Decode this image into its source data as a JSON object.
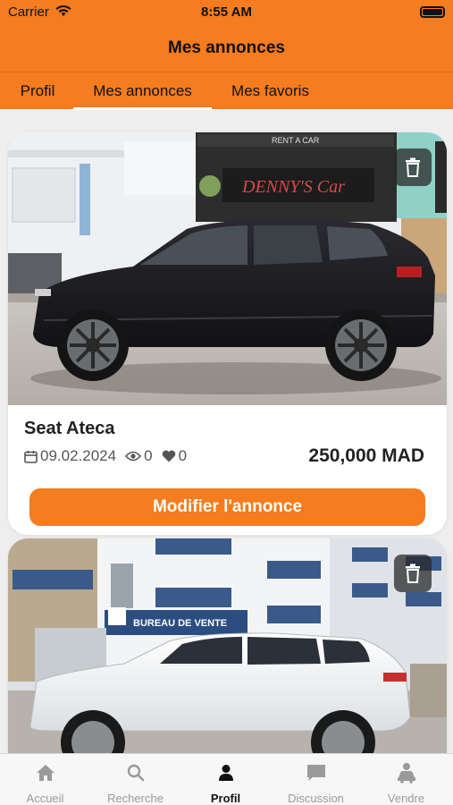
{
  "status_bar": {
    "carrier": "Carrier",
    "time": "8:55 AM"
  },
  "header": {
    "title": "Mes annonces"
  },
  "tabs": [
    {
      "label": "Profil",
      "active": false
    },
    {
      "label": "Mes annonces",
      "active": true
    },
    {
      "label": "Mes favoris",
      "active": false
    }
  ],
  "listings": [
    {
      "title": "Seat Ateca",
      "date": "09.02.2024",
      "views": "0",
      "likes": "0",
      "price": "250,000 MAD",
      "edit_label": "Modifier l'annonce",
      "photo": "black-suv-photo",
      "shop_sign": "DENNY'S Car",
      "shop_sign_small": "RENT A CAR"
    },
    {
      "photo": "white-suv-photo",
      "shop_sign": "BUREAU DE VENTE"
    }
  ],
  "bottom_nav": [
    {
      "label": "Accueil",
      "icon": "home-icon",
      "active": false
    },
    {
      "label": "Recherche",
      "icon": "search-icon",
      "active": false
    },
    {
      "label": "Profil",
      "icon": "person-icon",
      "active": true
    },
    {
      "label": "Discussion",
      "icon": "chat-icon",
      "active": false
    },
    {
      "label": "Vendre",
      "icon": "car-sell-icon",
      "active": false
    }
  ],
  "colors": {
    "accent": "#f57c1f",
    "background": "#eeeeee"
  }
}
